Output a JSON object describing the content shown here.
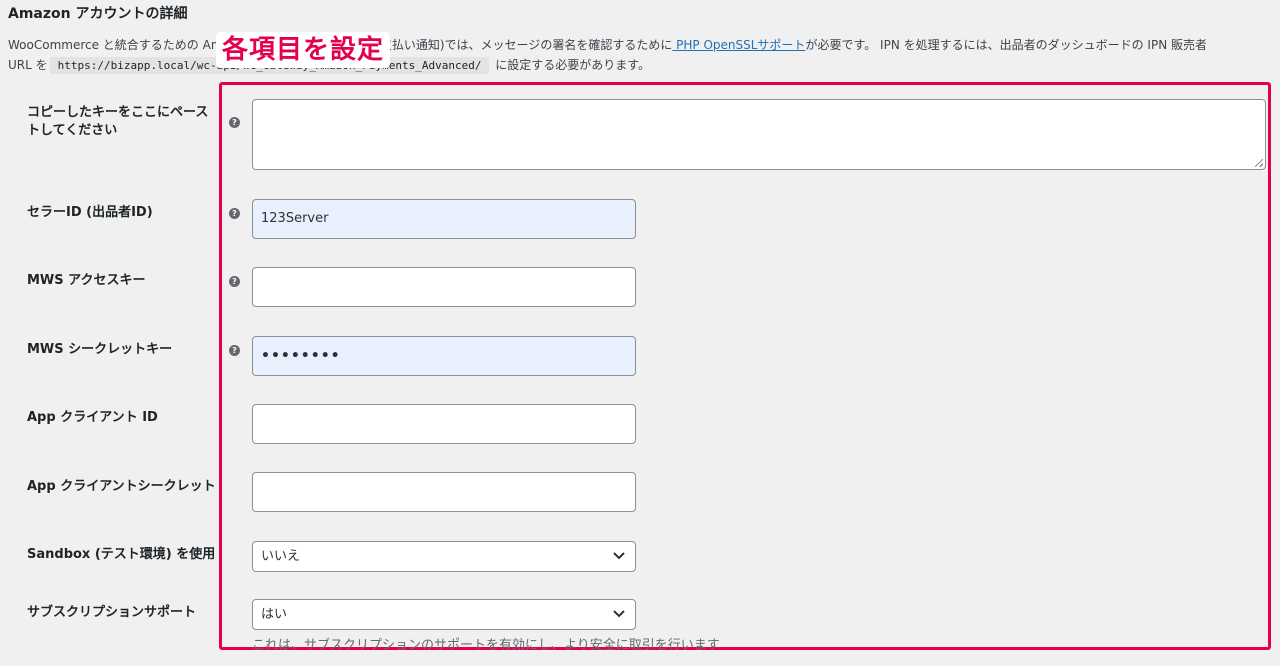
{
  "section": {
    "title": "Amazon アカウントの詳細"
  },
  "banner": {
    "text": "各項目を設定"
  },
  "description": {
    "part1": "WooCommerce と統合するための Ama",
    "part2": "支払い通知)では、メッセージの署名を確認するために",
    "link": " PHP OpenSSLサポート",
    "part3": "が必要です。 IPN を処理するには、出品者のダッシュボードの IPN 販売者",
    "part4": "URL を",
    "url": "https://bizapp.local/wc-api/WC_Gateway_Amazon_Payments_Advanced/",
    "part5": " に設定する必要があります。"
  },
  "fields": {
    "paste_key": {
      "label": "コピーしたキーをここにペーストしてください",
      "value": ""
    },
    "seller_id": {
      "label": "セラーID (出品者ID)",
      "value": "123Server"
    },
    "mws_access_key": {
      "label": "MWS アクセスキー",
      "value": ""
    },
    "mws_secret_key": {
      "label": "MWS シークレットキー",
      "value": "••••••••"
    },
    "app_client_id": {
      "label": "App クライアント ID",
      "value": ""
    },
    "app_client_secret": {
      "label": "App クライアントシークレット",
      "value": ""
    },
    "sandbox": {
      "label": "Sandbox (テスト環境) を使用",
      "value": "いいえ"
    },
    "subscriptions": {
      "label": "サブスクリプションサポート",
      "value": "はい",
      "note": "これは、サブスクリプションのサポートを有効にし、より安全に取引を行います"
    }
  },
  "icons": {
    "help": "?"
  },
  "colors": {
    "highlight": "#e5004f",
    "link": "#2271b1",
    "autofill": "#e8f0fe"
  }
}
